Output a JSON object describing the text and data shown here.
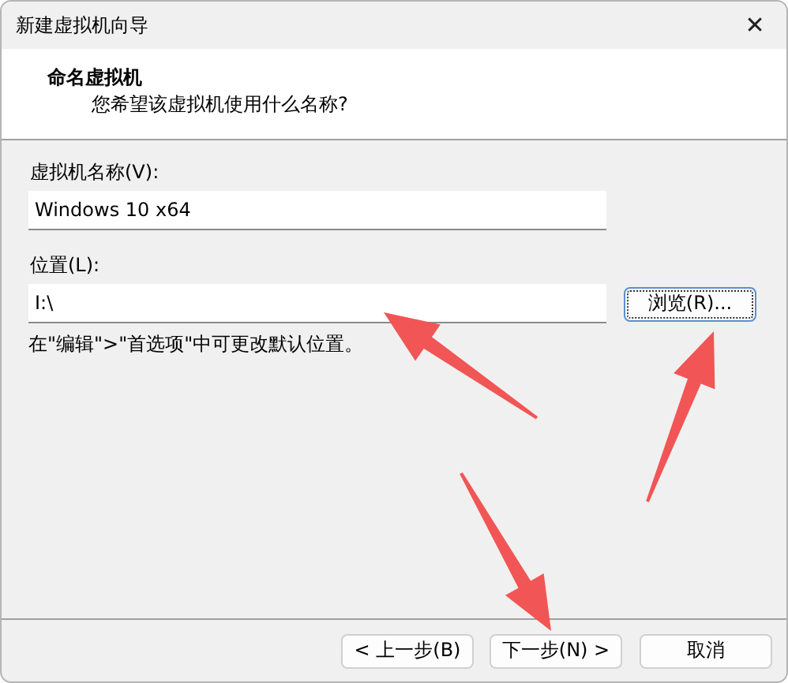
{
  "window": {
    "title": "新建虚拟机向导",
    "close": "✕"
  },
  "header": {
    "title": "命名虚拟机",
    "subtitle": "您希望该虚拟机使用什么名称?"
  },
  "name_field": {
    "label": "虚拟机名称(V):",
    "value": "Windows 10 x64"
  },
  "location_field": {
    "label": "位置(L):",
    "value": "I:\\",
    "browse": "浏览(R)...",
    "browse_focused": true
  },
  "hint": "在\"编辑\">\"首选项\"中可更改默认位置。",
  "buttons": [
    {
      "label": "< 上一步(B)"
    },
    {
      "label": "下一步(N) >"
    },
    {
      "label": "取消"
    }
  ]
}
